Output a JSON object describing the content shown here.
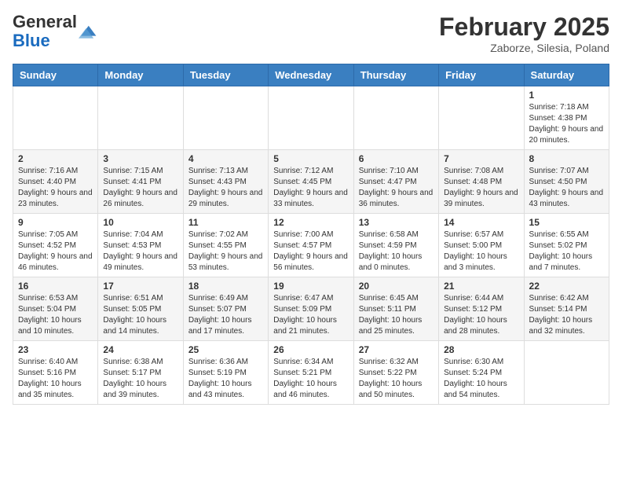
{
  "header": {
    "logo_general": "General",
    "logo_blue": "Blue",
    "month_year": "February 2025",
    "location": "Zaborze, Silesia, Poland"
  },
  "weekdays": [
    "Sunday",
    "Monday",
    "Tuesday",
    "Wednesday",
    "Thursday",
    "Friday",
    "Saturday"
  ],
  "weeks": [
    [
      null,
      null,
      null,
      null,
      null,
      null,
      {
        "day": "1",
        "sunrise": "7:18 AM",
        "sunset": "4:38 PM",
        "daylight": "9 hours and 20 minutes."
      }
    ],
    [
      {
        "day": "2",
        "sunrise": "7:16 AM",
        "sunset": "4:40 PM",
        "daylight": "9 hours and 23 minutes."
      },
      {
        "day": "3",
        "sunrise": "7:15 AM",
        "sunset": "4:41 PM",
        "daylight": "9 hours and 26 minutes."
      },
      {
        "day": "4",
        "sunrise": "7:13 AM",
        "sunset": "4:43 PM",
        "daylight": "9 hours and 29 minutes."
      },
      {
        "day": "5",
        "sunrise": "7:12 AM",
        "sunset": "4:45 PM",
        "daylight": "9 hours and 33 minutes."
      },
      {
        "day": "6",
        "sunrise": "7:10 AM",
        "sunset": "4:47 PM",
        "daylight": "9 hours and 36 minutes."
      },
      {
        "day": "7",
        "sunrise": "7:08 AM",
        "sunset": "4:48 PM",
        "daylight": "9 hours and 39 minutes."
      },
      {
        "day": "8",
        "sunrise": "7:07 AM",
        "sunset": "4:50 PM",
        "daylight": "9 hours and 43 minutes."
      }
    ],
    [
      {
        "day": "9",
        "sunrise": "7:05 AM",
        "sunset": "4:52 PM",
        "daylight": "9 hours and 46 minutes."
      },
      {
        "day": "10",
        "sunrise": "7:04 AM",
        "sunset": "4:53 PM",
        "daylight": "9 hours and 49 minutes."
      },
      {
        "day": "11",
        "sunrise": "7:02 AM",
        "sunset": "4:55 PM",
        "daylight": "9 hours and 53 minutes."
      },
      {
        "day": "12",
        "sunrise": "7:00 AM",
        "sunset": "4:57 PM",
        "daylight": "9 hours and 56 minutes."
      },
      {
        "day": "13",
        "sunrise": "6:58 AM",
        "sunset": "4:59 PM",
        "daylight": "10 hours and 0 minutes."
      },
      {
        "day": "14",
        "sunrise": "6:57 AM",
        "sunset": "5:00 PM",
        "daylight": "10 hours and 3 minutes."
      },
      {
        "day": "15",
        "sunrise": "6:55 AM",
        "sunset": "5:02 PM",
        "daylight": "10 hours and 7 minutes."
      }
    ],
    [
      {
        "day": "16",
        "sunrise": "6:53 AM",
        "sunset": "5:04 PM",
        "daylight": "10 hours and 10 minutes."
      },
      {
        "day": "17",
        "sunrise": "6:51 AM",
        "sunset": "5:05 PM",
        "daylight": "10 hours and 14 minutes."
      },
      {
        "day": "18",
        "sunrise": "6:49 AM",
        "sunset": "5:07 PM",
        "daylight": "10 hours and 17 minutes."
      },
      {
        "day": "19",
        "sunrise": "6:47 AM",
        "sunset": "5:09 PM",
        "daylight": "10 hours and 21 minutes."
      },
      {
        "day": "20",
        "sunrise": "6:45 AM",
        "sunset": "5:11 PM",
        "daylight": "10 hours and 25 minutes."
      },
      {
        "day": "21",
        "sunrise": "6:44 AM",
        "sunset": "5:12 PM",
        "daylight": "10 hours and 28 minutes."
      },
      {
        "day": "22",
        "sunrise": "6:42 AM",
        "sunset": "5:14 PM",
        "daylight": "10 hours and 32 minutes."
      }
    ],
    [
      {
        "day": "23",
        "sunrise": "6:40 AM",
        "sunset": "5:16 PM",
        "daylight": "10 hours and 35 minutes."
      },
      {
        "day": "24",
        "sunrise": "6:38 AM",
        "sunset": "5:17 PM",
        "daylight": "10 hours and 39 minutes."
      },
      {
        "day": "25",
        "sunrise": "6:36 AM",
        "sunset": "5:19 PM",
        "daylight": "10 hours and 43 minutes."
      },
      {
        "day": "26",
        "sunrise": "6:34 AM",
        "sunset": "5:21 PM",
        "daylight": "10 hours and 46 minutes."
      },
      {
        "day": "27",
        "sunrise": "6:32 AM",
        "sunset": "5:22 PM",
        "daylight": "10 hours and 50 minutes."
      },
      {
        "day": "28",
        "sunrise": "6:30 AM",
        "sunset": "5:24 PM",
        "daylight": "10 hours and 54 minutes."
      },
      null
    ]
  ]
}
